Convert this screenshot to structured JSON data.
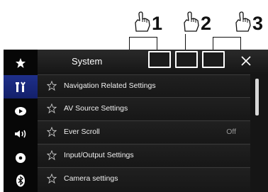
{
  "callouts": [
    {
      "number": "1",
      "icon": "pointing-hand-icon"
    },
    {
      "number": "2",
      "icon": "pointing-hand-icon"
    },
    {
      "number": "3",
      "icon": "pointing-hand-icon"
    }
  ],
  "sidebar": {
    "items": [
      {
        "icon": "star-icon",
        "active": false
      },
      {
        "icon": "settings-tools-icon",
        "active": true
      },
      {
        "icon": "navigation-icon",
        "active": false
      },
      {
        "icon": "speaker-icon",
        "active": false
      },
      {
        "icon": "disc-icon",
        "active": false
      },
      {
        "icon": "bluetooth-icon",
        "active": false
      }
    ]
  },
  "header": {
    "title": "System",
    "close_icon": "close-icon"
  },
  "menu": {
    "items": [
      {
        "label": "Navigation Related Settings",
        "value": ""
      },
      {
        "label": "AV Source Settings",
        "value": ""
      },
      {
        "label": "Ever Scroll",
        "value": "Off"
      },
      {
        "label": "Input/Output Settings",
        "value": ""
      },
      {
        "label": "Camera settings",
        "value": ""
      }
    ]
  },
  "colors": {
    "accent": "#1e2f8a",
    "background": "#1b1b1b",
    "text": "#f0f0f0",
    "value_text": "#999999"
  }
}
